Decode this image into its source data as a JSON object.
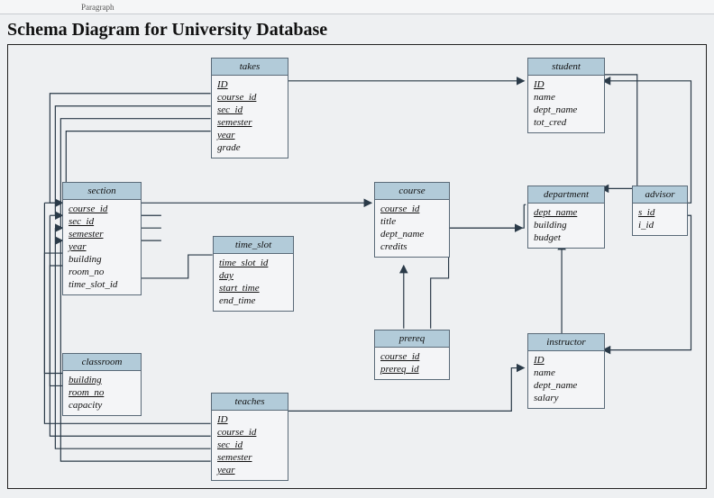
{
  "ribbon": {
    "label": "Paragraph"
  },
  "title": "Schema Diagram for University Database",
  "entities": {
    "takes": {
      "name": "takes",
      "attrs": [
        {
          "label": "ID",
          "pk": true
        },
        {
          "label": "course_id",
          "pk": true
        },
        {
          "label": "sec_id",
          "pk": true
        },
        {
          "label": "semester",
          "pk": true
        },
        {
          "label": "year",
          "pk": true
        },
        {
          "label": "grade",
          "pk": false
        }
      ]
    },
    "student": {
      "name": "student",
      "attrs": [
        {
          "label": "ID",
          "pk": true
        },
        {
          "label": "name",
          "pk": false
        },
        {
          "label": "dept_name",
          "pk": false
        },
        {
          "label": "tot_cred",
          "pk": false
        }
      ]
    },
    "section": {
      "name": "section",
      "attrs": [
        {
          "label": "course_id",
          "pk": true
        },
        {
          "label": "sec_id",
          "pk": true
        },
        {
          "label": "semester",
          "pk": true
        },
        {
          "label": "year",
          "pk": true
        },
        {
          "label": "building",
          "pk": false
        },
        {
          "label": "room_no",
          "pk": false
        },
        {
          "label": "time_slot_id",
          "pk": false
        }
      ]
    },
    "course": {
      "name": "course",
      "attrs": [
        {
          "label": "course_id",
          "pk": true
        },
        {
          "label": "title",
          "pk": false
        },
        {
          "label": "dept_name",
          "pk": false
        },
        {
          "label": "credits",
          "pk": false
        }
      ]
    },
    "department": {
      "name": "department",
      "attrs": [
        {
          "label": "dept_name",
          "pk": true
        },
        {
          "label": "building",
          "pk": false
        },
        {
          "label": "budget",
          "pk": false
        }
      ]
    },
    "advisor": {
      "name": "advisor",
      "attrs": [
        {
          "label": "s_id",
          "pk": true
        },
        {
          "label": "i_id",
          "pk": false
        }
      ]
    },
    "time_slot": {
      "name": "time_slot",
      "attrs": [
        {
          "label": "time_slot_id",
          "pk": true
        },
        {
          "label": "day",
          "pk": true
        },
        {
          "label": "start_time",
          "pk": true
        },
        {
          "label": "end_time",
          "pk": false
        }
      ]
    },
    "prereq": {
      "name": "prereq",
      "attrs": [
        {
          "label": "course_id",
          "pk": true
        },
        {
          "label": "prereq_id",
          "pk": true
        }
      ]
    },
    "instructor": {
      "name": "instructor",
      "attrs": [
        {
          "label": "ID",
          "pk": true
        },
        {
          "label": "name",
          "pk": false
        },
        {
          "label": "dept_name",
          "pk": false
        },
        {
          "label": "salary",
          "pk": false
        }
      ]
    },
    "classroom": {
      "name": "classroom",
      "attrs": [
        {
          "label": "building",
          "pk": true
        },
        {
          "label": "room_no",
          "pk": true
        },
        {
          "label": "capacity",
          "pk": false
        }
      ]
    },
    "teaches": {
      "name": "teaches",
      "attrs": [
        {
          "label": "ID",
          "pk": true
        },
        {
          "label": "course_id",
          "pk": true
        },
        {
          "label": "sec_id",
          "pk": true
        },
        {
          "label": "semester",
          "pk": true
        },
        {
          "label": "year",
          "pk": true
        }
      ]
    }
  }
}
